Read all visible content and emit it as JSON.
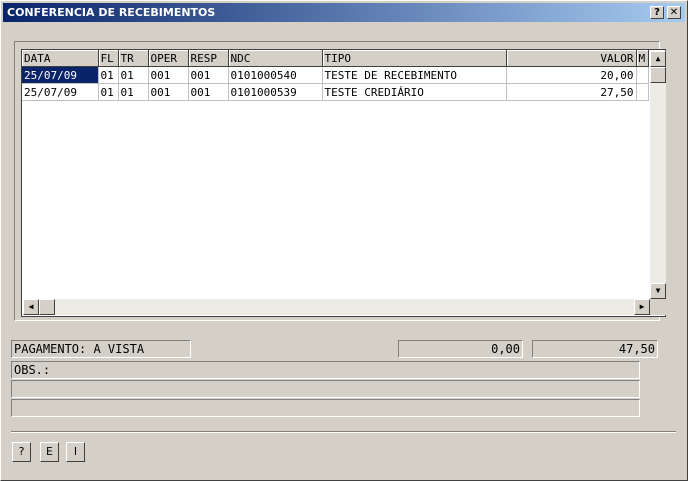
{
  "window": {
    "title": "CONFERENCIA DE RECEBIMENTOS",
    "help_button": "?",
    "close_button": "✕"
  },
  "grid": {
    "columns": [
      "DATA",
      "FL",
      "TR",
      "OPER",
      "RESP",
      "NDC",
      "TIPO",
      "VALOR",
      "M"
    ],
    "rows": [
      [
        "25/07/09",
        "01",
        "01",
        "001",
        "001",
        "0101000540",
        "TESTE DE RECEBIMENTO",
        "20,00",
        ""
      ],
      [
        "25/07/09",
        "01",
        "01",
        "001",
        "001",
        "0101000539",
        "TESTE CREDIÁRIO",
        "27,50",
        ""
      ]
    ]
  },
  "scrollbars": {
    "up": "▲",
    "down": "▼",
    "left": "◀",
    "right": "▶"
  },
  "summary": {
    "payment": "PAGAMENTO: A VISTA",
    "value1": "0,00",
    "value2": "47,50",
    "obs_label": "OBS.:",
    "obs_line2": "",
    "obs_line3": ""
  },
  "buttons": {
    "help": "?",
    "e": "E",
    "i": "I"
  }
}
